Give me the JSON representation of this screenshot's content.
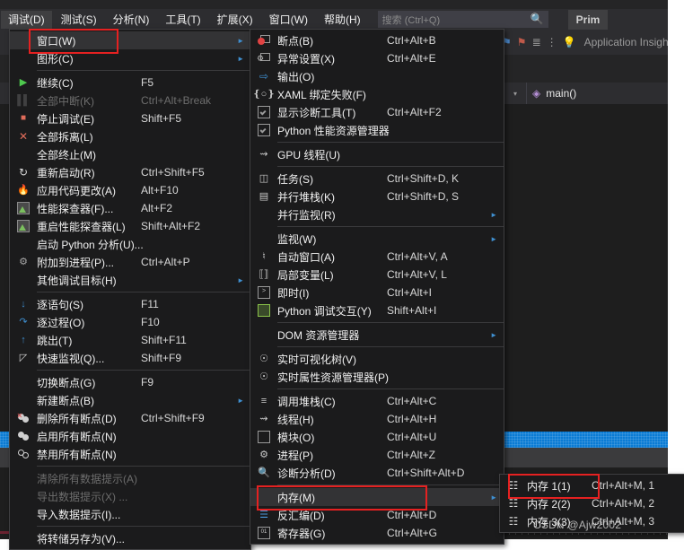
{
  "app": {
    "menubar": [
      {
        "label": "调试(D)",
        "active": true
      },
      {
        "label": "测试(S)",
        "active": false
      },
      {
        "label": "分析(N)",
        "active": false
      },
      {
        "label": "工具(T)",
        "active": false
      },
      {
        "label": "扩展(X)",
        "active": false
      },
      {
        "label": "窗口(W)",
        "active": false
      },
      {
        "label": "帮助(H)",
        "active": false
      }
    ],
    "search": {
      "placeholder": "搜索 (Ctrl+Q)",
      "value": "",
      "icon": "search-icon"
    },
    "profile_label": "Prim",
    "toolbar": {
      "app_insights_label": "Application Insights",
      "caret": "▾"
    },
    "navbar": {
      "symbol_label": "main()",
      "caret": "▾"
    },
    "watermark": "CSDN @Ajw2002",
    "accent_blue": "#0a7bd4",
    "highlight_red": "#e52121",
    "menu_bg": "#1b1b1c",
    "chrome_bg": "#2d2d30",
    "editor_bg": "#1e1e1e"
  },
  "debug_menu": {
    "items": [
      {
        "label": "窗口(W)",
        "accel": "",
        "icon": "",
        "submenu": true,
        "disabled": false,
        "highlighted": true,
        "boxed": true
      },
      {
        "label": "图形(C)",
        "accel": "",
        "icon": "",
        "submenu": true,
        "disabled": false
      },
      {
        "sep": true
      },
      {
        "label": "继续(C)",
        "accel": "F5",
        "icon": "play-icon",
        "disabled": false
      },
      {
        "label": "全部中断(K)",
        "accel": "Ctrl+Alt+Break",
        "icon": "pause-icon",
        "disabled": true
      },
      {
        "label": "停止调试(E)",
        "accel": "Shift+F5",
        "icon": "stop-icon",
        "disabled": false
      },
      {
        "label": "全部拆离(L)",
        "accel": "",
        "icon": "detach-all-icon",
        "disabled": false
      },
      {
        "label": "全部终止(M)",
        "accel": "",
        "icon": "",
        "disabled": false
      },
      {
        "label": "重新启动(R)",
        "accel": "Ctrl+Shift+F5",
        "icon": "restart-icon",
        "disabled": false
      },
      {
        "label": "应用代码更改(A)",
        "accel": "Alt+F10",
        "icon": "hot-reload-icon",
        "disabled": false
      },
      {
        "label": "性能探查器(F)...",
        "accel": "Alt+F2",
        "icon": "performance-profiler-icon",
        "disabled": false
      },
      {
        "label": "重启性能探查器(L)",
        "accel": "Shift+Alt+F2",
        "icon": "performance-profiler-icon",
        "disabled": false
      },
      {
        "label": "启动 Python 分析(U)...",
        "accel": "",
        "icon": "",
        "disabled": false
      },
      {
        "label": "附加到进程(P)...",
        "accel": "Ctrl+Alt+P",
        "icon": "attach-process-icon",
        "disabled": false
      },
      {
        "label": "其他调试目标(H)",
        "accel": "",
        "icon": "",
        "submenu": true,
        "disabled": false
      },
      {
        "sep": true
      },
      {
        "label": "逐语句(S)",
        "accel": "F11",
        "icon": "step-into-icon",
        "disabled": false
      },
      {
        "label": "逐过程(O)",
        "accel": "F10",
        "icon": "step-over-icon",
        "disabled": false
      },
      {
        "label": "跳出(T)",
        "accel": "Shift+F11",
        "icon": "step-out-icon",
        "disabled": false
      },
      {
        "label": "快速监视(Q)...",
        "accel": "Shift+F9",
        "icon": "quick-watch-icon",
        "disabled": false
      },
      {
        "sep": true
      },
      {
        "label": "切换断点(G)",
        "accel": "F9",
        "icon": "",
        "disabled": false
      },
      {
        "label": "新建断点(B)",
        "accel": "",
        "icon": "",
        "submenu": true,
        "disabled": false
      },
      {
        "label": "删除所有断点(D)",
        "accel": "Ctrl+Shift+F9",
        "icon": "delete-all-breakpoints-icon",
        "disabled": false
      },
      {
        "label": "启用所有断点(N)",
        "accel": "",
        "icon": "enable-all-breakpoints-icon",
        "disabled": false
      },
      {
        "label": "禁用所有断点(N)",
        "accel": "",
        "icon": "disable-all-breakpoints-icon",
        "disabled": false
      },
      {
        "sep": true
      },
      {
        "label": "清除所有数据提示(A)",
        "accel": "",
        "icon": "",
        "disabled": true
      },
      {
        "label": "导出数据提示(X) ...",
        "accel": "",
        "icon": "",
        "disabled": true
      },
      {
        "label": "导入数据提示(I)...",
        "accel": "",
        "icon": "",
        "disabled": false
      },
      {
        "sep": true
      },
      {
        "label": "将转储另存为(V)...",
        "accel": "",
        "icon": "",
        "disabled": false
      }
    ]
  },
  "windows_submenu": {
    "items": [
      {
        "label": "断点(B)",
        "accel": "Ctrl+Alt+B",
        "icon": "breakpoint-icon"
      },
      {
        "label": "异常设置(X)",
        "accel": "Ctrl+Alt+E",
        "icon": "exception-settings-icon"
      },
      {
        "label": "输出(O)",
        "accel": "",
        "icon": "output-icon"
      },
      {
        "label": "XAML 绑定失败(F)",
        "accel": "",
        "icon": "xaml-binding-icon"
      },
      {
        "label": "显示诊断工具(T)",
        "accel": "Ctrl+Alt+F2",
        "icon": "diagnostic-tools-icon"
      },
      {
        "label": "Python 性能资源管理器",
        "accel": "",
        "icon": "python-perf-icon"
      },
      {
        "sep": true
      },
      {
        "label": "GPU 线程(U)",
        "accel": "",
        "icon": "gpu-threads-icon"
      },
      {
        "sep": true
      },
      {
        "label": "任务(S)",
        "accel": "Ctrl+Shift+D, K",
        "icon": "tasks-icon"
      },
      {
        "label": "并行堆栈(K)",
        "accel": "Ctrl+Shift+D, S",
        "icon": "parallel-stacks-icon"
      },
      {
        "label": "并行监视(R)",
        "accel": "",
        "icon": "",
        "submenu": true
      },
      {
        "sep": true
      },
      {
        "label": "监视(W)",
        "accel": "",
        "icon": "",
        "submenu": true
      },
      {
        "label": "自动窗口(A)",
        "accel": "Ctrl+Alt+V, A",
        "icon": "autos-icon"
      },
      {
        "label": "局部变量(L)",
        "accel": "Ctrl+Alt+V, L",
        "icon": "locals-icon"
      },
      {
        "label": "即时(I)",
        "accel": "Ctrl+Alt+I",
        "icon": "immediate-window-icon"
      },
      {
        "label": "Python 调试交互(Y)",
        "accel": "Shift+Alt+I",
        "icon": "python-interactive-icon"
      },
      {
        "sep": true
      },
      {
        "label": "DOM 资源管理器",
        "accel": "",
        "icon": "",
        "submenu": true
      },
      {
        "sep": true
      },
      {
        "label": "实时可视化树(V)",
        "accel": "",
        "icon": "live-visual-tree-icon"
      },
      {
        "label": "实时属性资源管理器(P)",
        "accel": "",
        "icon": "live-property-explorer-icon"
      },
      {
        "sep": true
      },
      {
        "label": "调用堆栈(C)",
        "accel": "Ctrl+Alt+C",
        "icon": "call-stack-icon"
      },
      {
        "label": "线程(H)",
        "accel": "Ctrl+Alt+H",
        "icon": "threads-icon"
      },
      {
        "label": "模块(O)",
        "accel": "Ctrl+Alt+U",
        "icon": "modules-icon"
      },
      {
        "label": "进程(P)",
        "accel": "Ctrl+Alt+Z",
        "icon": "processes-icon"
      },
      {
        "label": "诊断分析(D)",
        "accel": "Ctrl+Shift+Alt+D",
        "icon": "diagnostic-analysis-icon"
      },
      {
        "sep": true
      },
      {
        "label": "内存(M)",
        "accel": "",
        "icon": "",
        "submenu": true,
        "highlighted": true,
        "boxed": true
      },
      {
        "label": "反汇编(D)",
        "accel": "Ctrl+Alt+D",
        "icon": "disassembly-icon"
      },
      {
        "label": "寄存器(G)",
        "accel": "Ctrl+Alt+G",
        "icon": "registers-icon"
      }
    ]
  },
  "memory_submenu": {
    "items": [
      {
        "label": "内存 1(1)",
        "accel": "Ctrl+Alt+M, 1",
        "icon": "memory-icon",
        "boxed": true
      },
      {
        "label": "内存 2(2)",
        "accel": "Ctrl+Alt+M, 2",
        "icon": "memory-icon"
      },
      {
        "label": "内存 3(3)",
        "accel": "Ctrl+Alt+M, 3",
        "icon": "memory-icon"
      }
    ]
  }
}
